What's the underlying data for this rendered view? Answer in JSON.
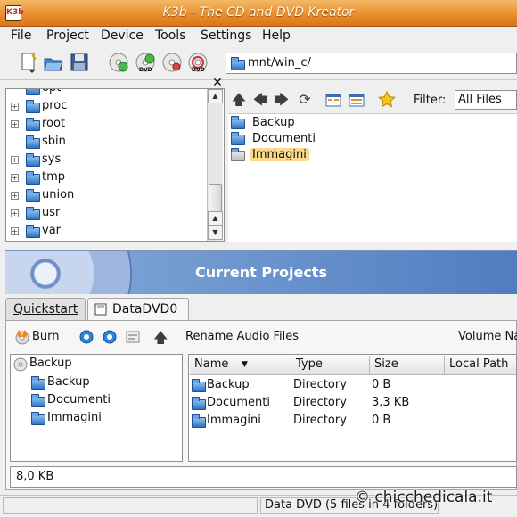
{
  "window": {
    "title": "K3b - The CD and DVD Kreator",
    "app_icon": "K3b"
  },
  "menu": [
    "File",
    "Project",
    "Device",
    "Tools",
    "Settings",
    "Help"
  ],
  "address": {
    "value": "mnt/win_c/"
  },
  "tree": {
    "items": [
      {
        "label": "opt",
        "expandable": false
      },
      {
        "label": "proc",
        "expandable": true
      },
      {
        "label": "root",
        "expandable": true
      },
      {
        "label": "sbin",
        "expandable": false
      },
      {
        "label": "sys",
        "expandable": true
      },
      {
        "label": "tmp",
        "expandable": true
      },
      {
        "label": "union",
        "expandable": true
      },
      {
        "label": "usr",
        "expandable": true
      },
      {
        "label": "var",
        "expandable": true
      }
    ]
  },
  "filter": {
    "label": "Filter:",
    "value": "All Files"
  },
  "files": [
    {
      "label": "Backup",
      "selected": false
    },
    {
      "label": "Documenti",
      "selected": false
    },
    {
      "label": "Immagini",
      "selected": true
    }
  ],
  "projects": {
    "title": "Current Projects"
  },
  "tabs": [
    {
      "label": "Quickstart"
    },
    {
      "label": "DataDVD0"
    }
  ],
  "project_toolbar": {
    "burn": "Burn",
    "rename": "Rename Audio Files",
    "volume": "Volume Na"
  },
  "data_tree": {
    "root": "Backup",
    "children": [
      "Backup",
      "Documenti",
      "Immagini"
    ]
  },
  "columns": [
    "Name",
    "Type",
    "Size",
    "Local Path"
  ],
  "rows": [
    {
      "name": "Backup",
      "type": "Directory",
      "size": "0 B"
    },
    {
      "name": "Documenti",
      "type": "Directory",
      "size": "3,3 KB"
    },
    {
      "name": "Immagini",
      "type": "Directory",
      "size": "0 B"
    }
  ],
  "size_display": "8,0 KB",
  "status": {
    "project": "Data DVD (5 files in 4 folders)"
  },
  "watermark": "© chicchedicala.it",
  "colors": {
    "titlebar": "#e98f2c",
    "banner": "#4f7dc0",
    "folder": "#2d72c4"
  }
}
